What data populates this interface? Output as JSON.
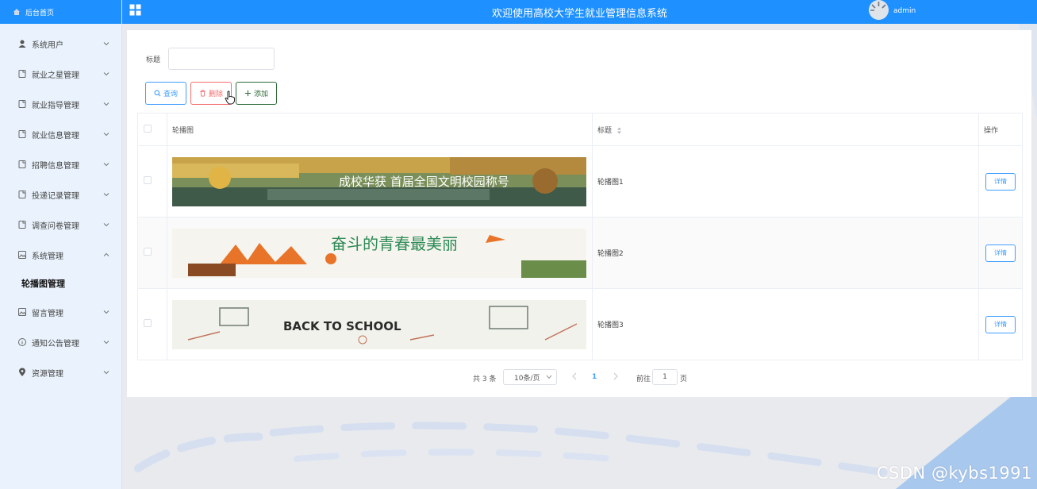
{
  "sidebar": {
    "home_label": "后台首页",
    "items": [
      {
        "label": "系统用户",
        "icon": "user-icon"
      },
      {
        "label": "就业之星管理",
        "icon": "doc-icon"
      },
      {
        "label": "就业指导管理",
        "icon": "doc-icon"
      },
      {
        "label": "就业信息管理",
        "icon": "doc-icon"
      },
      {
        "label": "招聘信息管理",
        "icon": "doc-icon"
      },
      {
        "label": "投递记录管理",
        "icon": "doc-icon"
      },
      {
        "label": "调查问卷管理",
        "icon": "doc-icon"
      },
      {
        "label": "系统管理",
        "icon": "image-icon"
      },
      {
        "label": "留言管理",
        "icon": "image-icon"
      },
      {
        "label": "通知公告管理",
        "icon": "info-icon"
      },
      {
        "label": "资源管理",
        "icon": "location-icon"
      }
    ],
    "submenu_active": "轮播图管理"
  },
  "header": {
    "title": "欢迎使用高校大学生就业管理信息系统",
    "username": "admin"
  },
  "search": {
    "label": "标题",
    "value": ""
  },
  "buttons": {
    "query": "查询",
    "delete": "删除",
    "add": "添加"
  },
  "table": {
    "headers": {
      "image": "轮播图",
      "title": "标题",
      "actions": "操作"
    },
    "rows": [
      {
        "title": "轮播图1",
        "action": "详情",
        "image_caption": "成校华获 首届全国文明校园称号"
      },
      {
        "title": "轮播图2",
        "action": "详情",
        "image_caption": "奋斗的青春最美丽"
      },
      {
        "title": "轮播图3",
        "action": "详情",
        "image_caption": "BACK TO SCHOOL"
      }
    ]
  },
  "pagination": {
    "total": "共 3 条",
    "page_size": "10条/页",
    "current_page": "1",
    "goto_label": "前往",
    "goto_value": "1",
    "page_suffix": "页"
  },
  "watermark": "CSDN @kybs1991",
  "colors": {
    "primary": "#1e90ff",
    "link": "#409eff",
    "danger": "#f56c6c",
    "add": "#2f6b3a"
  }
}
